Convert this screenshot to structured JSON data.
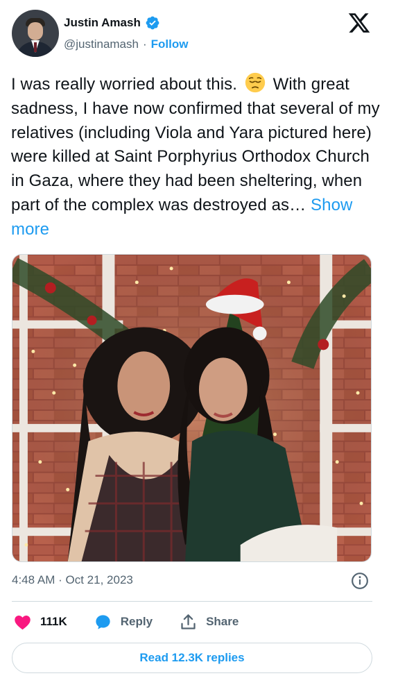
{
  "author": {
    "name": "Justin Amash",
    "handle": "@justinamash",
    "separator": "·",
    "follow_label": "Follow"
  },
  "tweet": {
    "text_part1": "I was really worried about this.",
    "emoji": "pensive-face",
    "text_part2": "With great sadness, I have now confirmed that several of my relatives (including Viola and Yara pictured here) were killed at Saint Porphyrius Orthodox Church in Gaza, where they had been sheltering, when part of the complex was destroyed as…",
    "show_more_label": "Show more"
  },
  "photo": {
    "subject": "two-women-in-front-of-christmas-decorated-brick-wall"
  },
  "meta": {
    "time": "4:48 AM",
    "separator": "·",
    "date": "Oct 21, 2023"
  },
  "actions": {
    "likes_count": "111K",
    "reply_label": "Reply",
    "share_label": "Share"
  },
  "read_replies_label": "Read 12.3K replies",
  "colors": {
    "accent": "#1d9bf0",
    "like": "#f91880",
    "text": "#0f1419",
    "secondary": "#536471",
    "border": "#cfd9de"
  }
}
